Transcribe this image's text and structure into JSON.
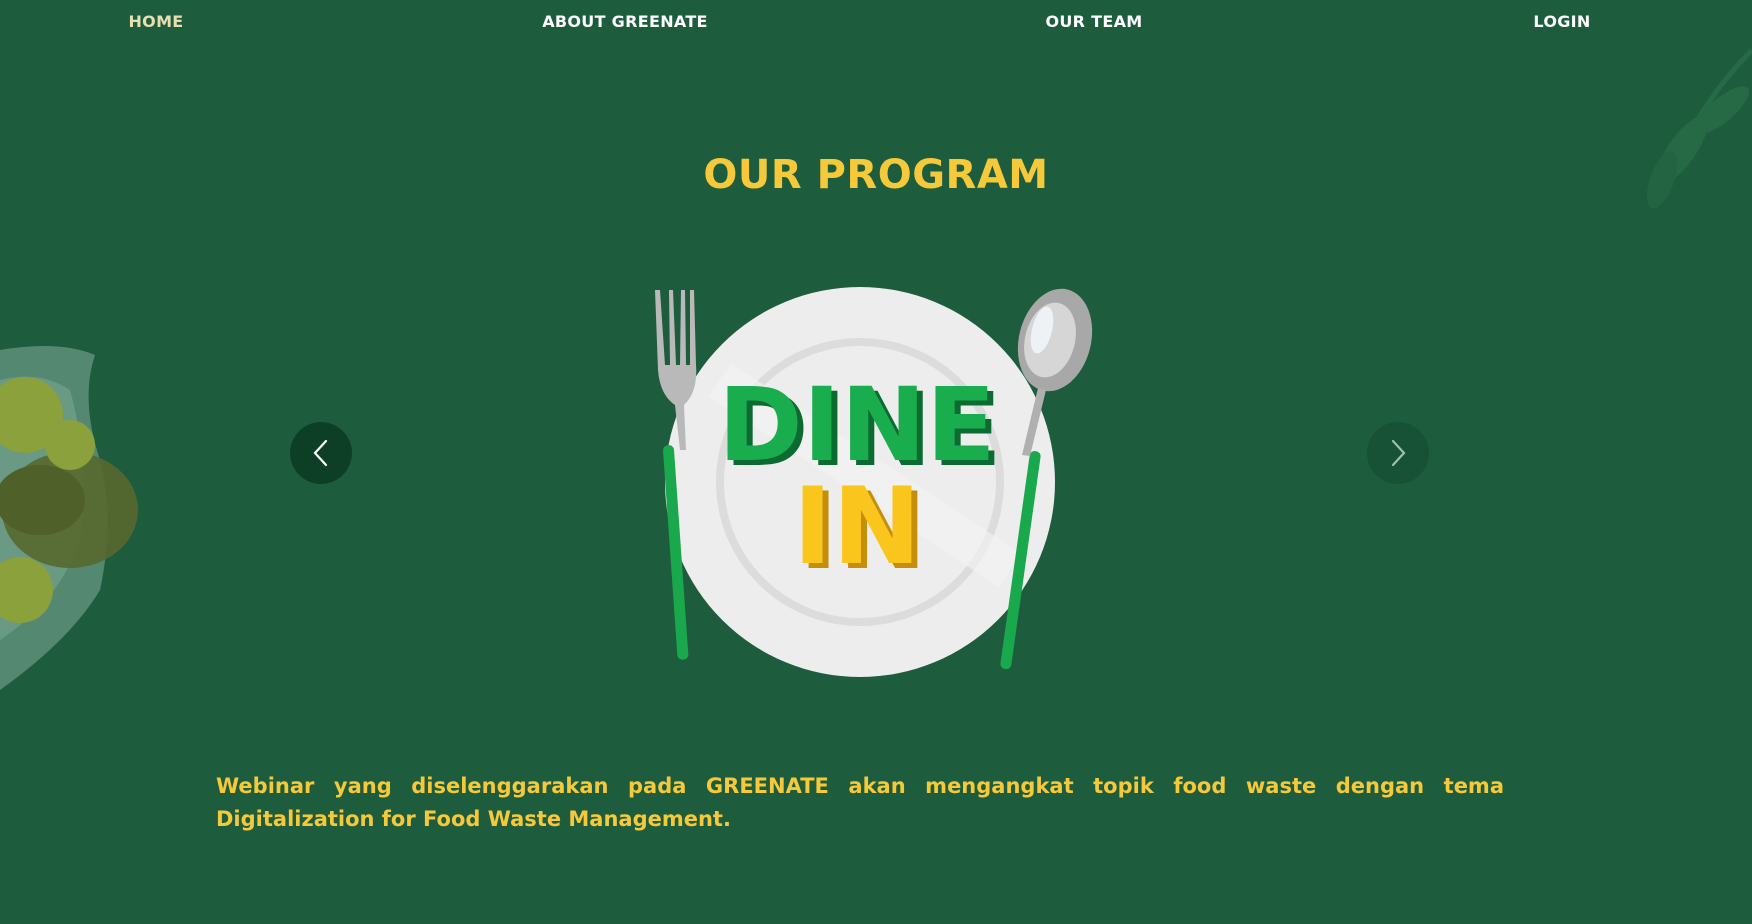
{
  "nav": {
    "home": "HOME",
    "about": "ABOUT GREENATE",
    "team": "OUR TEAM",
    "login": "LOGIN"
  },
  "program": {
    "title": "OUR PROGRAM",
    "slide": {
      "image_text_line1": "DINE",
      "image_text_line2": "IN"
    },
    "description": "Webinar yang diselenggarakan pada GREENATE akan mengangkat topik food waste dengan tema Digitalization for Food Waste Management."
  },
  "icons": {
    "prev": "chevron-left-icon",
    "next": "chevron-right-icon"
  },
  "colors": {
    "background": "#1e5c3e",
    "accent_yellow": "#f5c93a",
    "brand_green": "#1aa84c",
    "arrow_dark": "#0d3f27"
  }
}
